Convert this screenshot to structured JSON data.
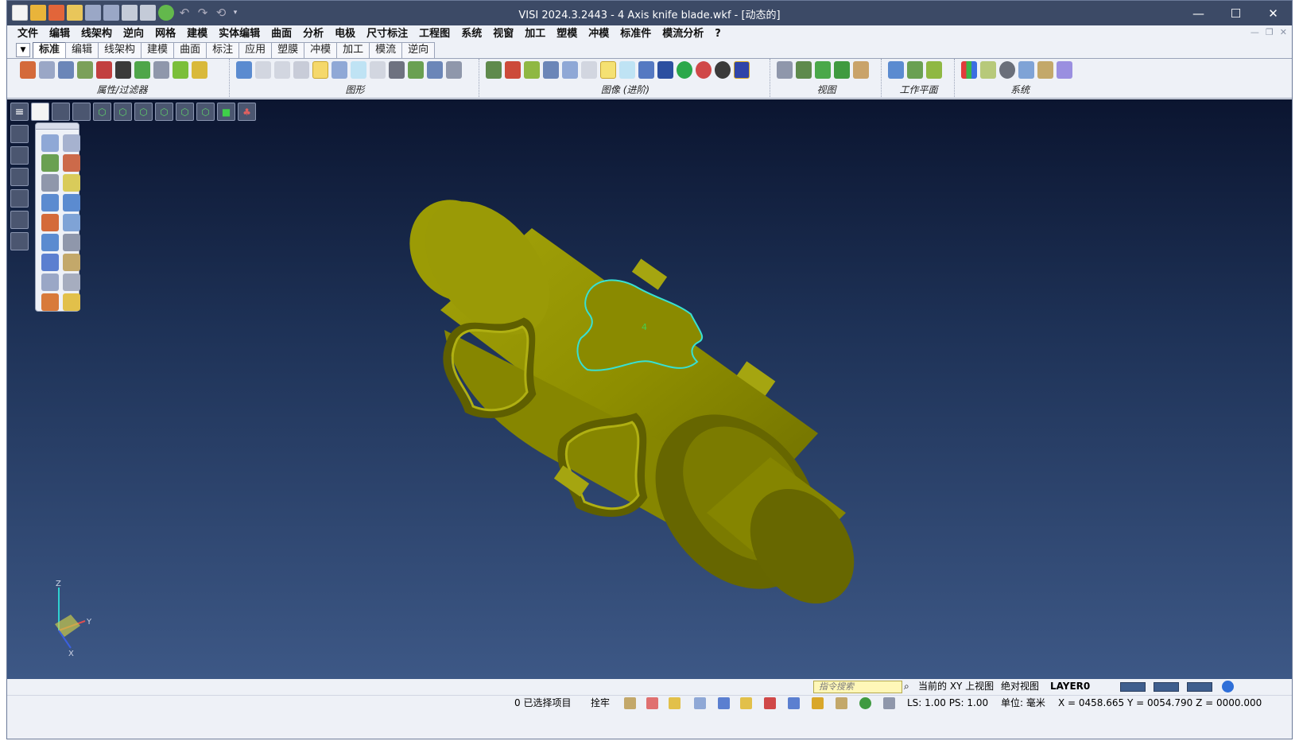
{
  "window": {
    "title": "VISI 2024.3.2443 - 4 Axis knife blade.wkf - [动态的]",
    "minimize": "—",
    "maximize": "☐",
    "close": "✕"
  },
  "menu": [
    "文件",
    "编辑",
    "线架构",
    "逆向",
    "网格",
    "建模",
    "实体编辑",
    "曲面",
    "分析",
    "电极",
    "尺寸标注",
    "工程图",
    "系统",
    "视窗",
    "加工",
    "塑模",
    "冲模",
    "标准件",
    "模流分析",
    "?"
  ],
  "tabs": [
    "标准",
    "编辑",
    "线架构",
    "建模",
    "曲面",
    "标注",
    "应用",
    "塑膜",
    "冲模",
    "加工",
    "模流",
    "逆向"
  ],
  "active_tab": "标准",
  "ribbon_groups": [
    {
      "label": "属性/过滤器",
      "icons": [
        "attribute-icon",
        "trash-icon",
        "search-icon",
        "wire-icon",
        "magnet-icon",
        "magnet-icon",
        "filter-icon",
        "filter-icon",
        "plus-icon",
        "minus-icon"
      ]
    },
    {
      "label": "图形",
      "icons": [
        "refresh-icon",
        "layer-icon",
        "layer-icon",
        "layer-icon",
        "layer-icon",
        "layer-icon",
        "layer-icon",
        "layer-icon",
        "layer-icon",
        "layer-icon",
        "layer-icon",
        "layer-icon"
      ]
    },
    {
      "label": "图像 (进阶)",
      "icons": [
        "render-icon",
        "render-icon",
        "render-icon",
        "render-icon",
        "cylinder-icon",
        "cylinder-icon",
        "highlight-icon",
        "cylinder-icon",
        "cylinder-icon",
        "cube-icon",
        "sphere-icon",
        "pie-icon",
        "sphere-icon",
        "cube-icon"
      ]
    },
    {
      "label": "视图",
      "icons": [
        "zoom-icon",
        "zoom-icon",
        "arrow-icon",
        "rotate-icon",
        "eye-icon"
      ]
    },
    {
      "label": "工作平面",
      "icons": [
        "plane-icon",
        "plane-icon",
        "plane-icon"
      ]
    },
    {
      "label": "系统",
      "icons": [
        "palette-icon",
        "image-icon",
        "settings-icon",
        "grid-icon",
        "grid-icon",
        "plane-icon"
      ]
    }
  ],
  "colors": {
    "model_body": "#8e8e00",
    "model_highlight": "#b0b012",
    "model_dark": "#5f5f00",
    "selection_outline": "#38e0d2",
    "viewport_top": "#0b1530",
    "viewport_bottom": "#3d5886"
  },
  "viewport": {
    "selection_label": "4"
  },
  "axis": {
    "z": "Z",
    "y": "Y",
    "x": "X"
  },
  "status": {
    "command_search_placeholder": "指令搜索",
    "current_view": "当前的 XY 上视图",
    "absolute_view": "绝对视图",
    "layer": "LAYER0",
    "selected_items": "0 已选择项目",
    "snap": "拴牢",
    "ls_ps": "LS: 1.00 PS: 1.00",
    "unit": "单位: 毫米",
    "coordinates": "X = 0458.665 Y = 0054.790 Z = 0000.000"
  }
}
